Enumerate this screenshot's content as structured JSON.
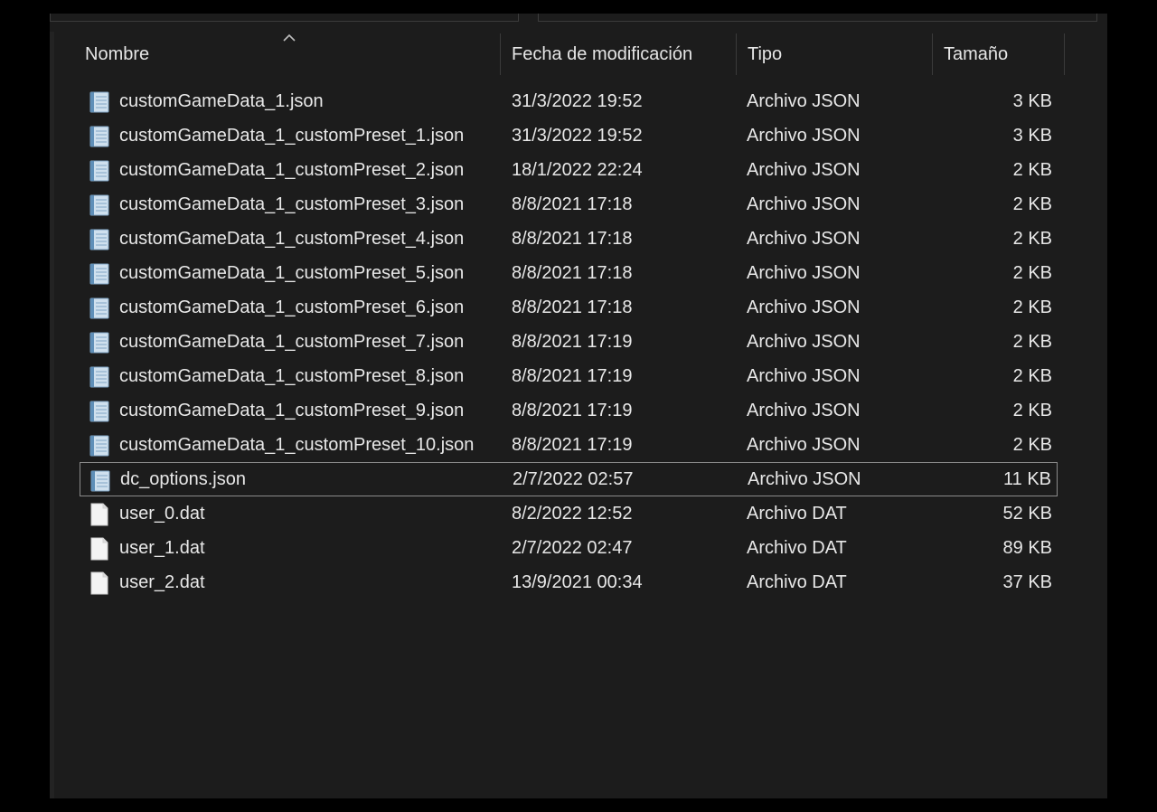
{
  "columns": {
    "name": "Nombre",
    "date": "Fecha de modificación",
    "type": "Tipo",
    "size": "Tamaño"
  },
  "icons": {
    "json": "json-file-icon",
    "dat": "blank-file-icon",
    "sort": "sort-ascending-icon"
  },
  "colors": {
    "background": "#1c1c1c",
    "text": "#e6e6e6",
    "selection_border": "#8a8a8a",
    "json_icon": "#cfe0ee"
  },
  "files": [
    {
      "name": "customGameData_1.json",
      "date": "31/3/2022 19:52",
      "type": "Archivo JSON",
      "size": "3 KB",
      "kind": "json"
    },
    {
      "name": "customGameData_1_customPreset_1.json",
      "date": "31/3/2022 19:52",
      "type": "Archivo JSON",
      "size": "3 KB",
      "kind": "json"
    },
    {
      "name": "customGameData_1_customPreset_2.json",
      "date": "18/1/2022 22:24",
      "type": "Archivo JSON",
      "size": "2 KB",
      "kind": "json"
    },
    {
      "name": "customGameData_1_customPreset_3.json",
      "date": "8/8/2021 17:18",
      "type": "Archivo JSON",
      "size": "2 KB",
      "kind": "json"
    },
    {
      "name": "customGameData_1_customPreset_4.json",
      "date": "8/8/2021 17:18",
      "type": "Archivo JSON",
      "size": "2 KB",
      "kind": "json"
    },
    {
      "name": "customGameData_1_customPreset_5.json",
      "date": "8/8/2021 17:18",
      "type": "Archivo JSON",
      "size": "2 KB",
      "kind": "json"
    },
    {
      "name": "customGameData_1_customPreset_6.json",
      "date": "8/8/2021 17:18",
      "type": "Archivo JSON",
      "size": "2 KB",
      "kind": "json"
    },
    {
      "name": "customGameData_1_customPreset_7.json",
      "date": "8/8/2021 17:19",
      "type": "Archivo JSON",
      "size": "2 KB",
      "kind": "json"
    },
    {
      "name": "customGameData_1_customPreset_8.json",
      "date": "8/8/2021 17:19",
      "type": "Archivo JSON",
      "size": "2 KB",
      "kind": "json"
    },
    {
      "name": "customGameData_1_customPreset_9.json",
      "date": "8/8/2021 17:19",
      "type": "Archivo JSON",
      "size": "2 KB",
      "kind": "json"
    },
    {
      "name": "customGameData_1_customPreset_10.json",
      "date": "8/8/2021 17:19",
      "type": "Archivo JSON",
      "size": "2 KB",
      "kind": "json"
    },
    {
      "name": "dc_options.json",
      "date": "2/7/2022 02:57",
      "type": "Archivo JSON",
      "size": "11 KB",
      "kind": "json",
      "selected": true
    },
    {
      "name": "user_0.dat",
      "date": "8/2/2022 12:52",
      "type": "Archivo DAT",
      "size": "52 KB",
      "kind": "dat"
    },
    {
      "name": "user_1.dat",
      "date": "2/7/2022 02:47",
      "type": "Archivo DAT",
      "size": "89 KB",
      "kind": "dat"
    },
    {
      "name": "user_2.dat",
      "date": "13/9/2021 00:34",
      "type": "Archivo DAT",
      "size": "37 KB",
      "kind": "dat"
    }
  ]
}
